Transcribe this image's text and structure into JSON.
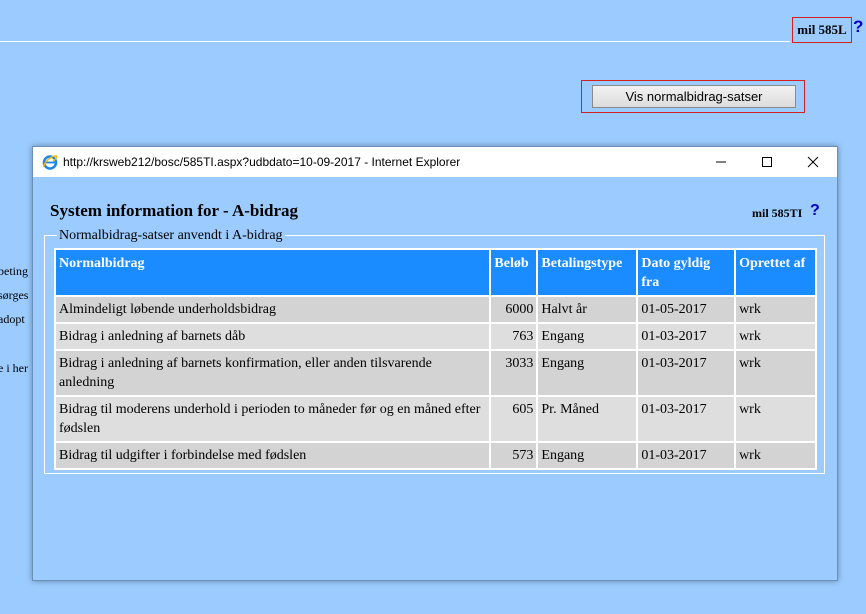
{
  "page": {
    "code": "mil 585L",
    "help": "?",
    "show_rates_button": "Vis normalbidrag-satser",
    "background_fragments": [
      "beting",
      "sørges",
      "adopt",
      "e i her"
    ]
  },
  "popup": {
    "url_title": "http://krsweb212/bosc/585TI.aspx?udbdato=10-09-2017 - Internet Explorer",
    "heading": "System information for - A-bidrag",
    "code": "mil 585TI",
    "help": "?",
    "legend": "Normalbidrag-satser anvendt i A-bidrag",
    "columns": [
      "Normalbidrag",
      "Beløb",
      "Betalingstype",
      "Dato gyldig fra",
      "Oprettet af"
    ],
    "rows": [
      {
        "name": "Almindeligt løbende underholdsbidrag",
        "amount": "6000",
        "type": "Halvt år",
        "date": "01-05-2017",
        "by": "wrk"
      },
      {
        "name": "Bidrag i anledning af barnets dåb",
        "amount": "763",
        "type": "Engang",
        "date": "01-03-2017",
        "by": "wrk"
      },
      {
        "name": "Bidrag i anledning af barnets konfirmation, eller anden tilsvarende anledning",
        "amount": "3033",
        "type": "Engang",
        "date": "01-03-2017",
        "by": "wrk"
      },
      {
        "name": "Bidrag til moderens underhold i perioden to måneder før og en måned efter fødslen",
        "amount": "605",
        "type": "Pr. Måned",
        "date": "01-03-2017",
        "by": "wrk"
      },
      {
        "name": "Bidrag til udgifter i forbindelse med fødslen",
        "amount": "573",
        "type": "Engang",
        "date": "01-03-2017",
        "by": "wrk"
      }
    ]
  }
}
